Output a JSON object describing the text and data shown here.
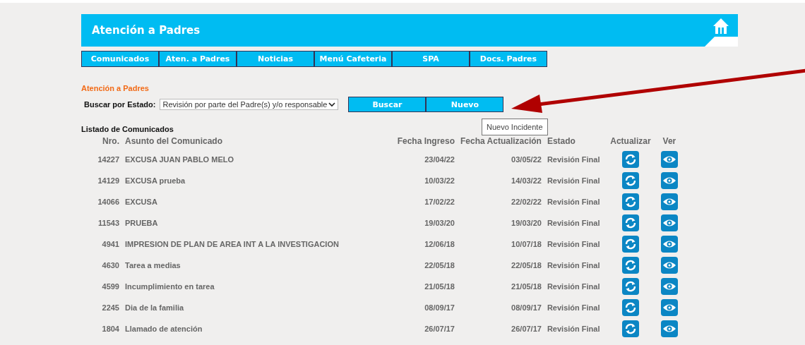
{
  "header": {
    "title": "Atención a Padres"
  },
  "nav": [
    {
      "label": "Comunicados"
    },
    {
      "label": "Aten. a Padres"
    },
    {
      "label": "Noticias"
    },
    {
      "label": "Menú Cafeteria"
    },
    {
      "label": "SPA"
    },
    {
      "label": "Docs. Padres"
    }
  ],
  "section_title": "Atención a Padres",
  "search": {
    "label": "Buscar por Estado:",
    "value": "Revisión por parte del Padre(s) y/o responsable",
    "buttons": [
      "Buscar",
      "Nuevo"
    ]
  },
  "tooltip": "Nuevo Incidente",
  "list_title": "Listado de Comunicados",
  "table": {
    "columns": [
      "Nro.",
      "Asunto del Comunicado",
      "Fecha Ingreso",
      "Fecha Actualización",
      "Estado",
      "Actualizar",
      "Ver"
    ],
    "rows": [
      {
        "nro": "14227",
        "asunto": "EXCUSA JUAN PABLO MELO",
        "ingreso": "23/04/22",
        "actualizacion": "03/05/22",
        "estado": "Revisión Final"
      },
      {
        "nro": "14129",
        "asunto": "EXCUSA prueba",
        "ingreso": "10/03/22",
        "actualizacion": "14/03/22",
        "estado": "Revisión Final"
      },
      {
        "nro": "14066",
        "asunto": "EXCUSA",
        "ingreso": "17/02/22",
        "actualizacion": "22/02/22",
        "estado": "Revisión Final"
      },
      {
        "nro": "11543",
        "asunto": "PRUEBA",
        "ingreso": "19/03/20",
        "actualizacion": "19/03/20",
        "estado": "Revisión Final"
      },
      {
        "nro": "4941",
        "asunto": "IMPRESION DE PLAN DE AREA INT A LA INVESTIGACION",
        "ingreso": "12/06/18",
        "actualizacion": "10/07/18",
        "estado": "Revisión Final"
      },
      {
        "nro": "4630",
        "asunto": "Tarea a medias",
        "ingreso": "22/05/18",
        "actualizacion": "22/05/18",
        "estado": "Revisión Final"
      },
      {
        "nro": "4599",
        "asunto": "Incumplimiento en tarea",
        "ingreso": "21/05/18",
        "actualizacion": "21/05/18",
        "estado": "Revisión Final"
      },
      {
        "nro": "2245",
        "asunto": "Dia de la familia",
        "ingreso": "08/09/17",
        "actualizacion": "08/09/17",
        "estado": "Revisión Final"
      },
      {
        "nro": "1804",
        "asunto": "Llamado de atención",
        "ingreso": "26/07/17",
        "actualizacion": "26/07/17",
        "estado": "Revisión Final"
      }
    ]
  }
}
